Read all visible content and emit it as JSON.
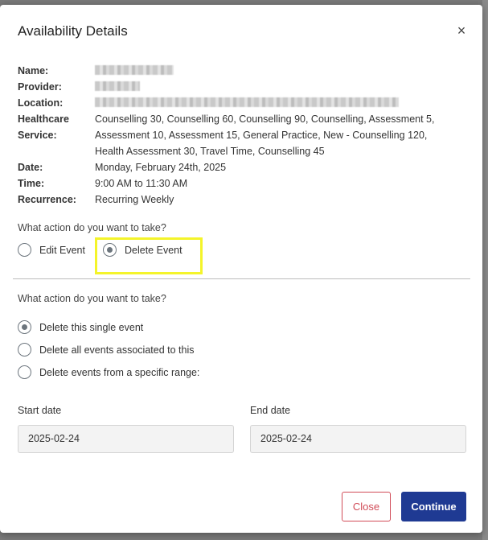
{
  "modal": {
    "title": "Availability Details",
    "close_icon": "×"
  },
  "details": {
    "name_label": "Name:",
    "provider_label": "Provider:",
    "location_label": "Location:",
    "healthcare_label_1": "Healthcare",
    "healthcare_label_2": "Service:",
    "healthcare_line_1": "Counselling 30, Counselling 60, Counselling 90, Counselling, Assessment 5,",
    "healthcare_line_2": "Assessment 10, Assessment 15, General Practice, New - Counselling 120,",
    "healthcare_line_3": "Health Assessment 30, Travel Time, Counselling 45",
    "date_label": "Date:",
    "date_value": "Monday, February 24th, 2025",
    "time_label": "Time:",
    "time_value": "9:00 AM to 11:30 AM",
    "recurrence_label": "Recurrence:",
    "recurrence_value": "Recurring Weekly"
  },
  "action": {
    "question": "What action do you want to take?",
    "options": [
      {
        "label": "Edit Event",
        "checked": false
      },
      {
        "label": "Delete Event",
        "checked": true
      }
    ]
  },
  "delete_scope": {
    "question": "What action do you want to take?",
    "options": [
      {
        "label": "Delete this single event",
        "checked": true
      },
      {
        "label": "Delete all events associated to this",
        "checked": false
      },
      {
        "label": "Delete events from a specific range:",
        "checked": false
      }
    ]
  },
  "range": {
    "start_label": "Start date",
    "start_value": "2025-02-24",
    "end_label": "End date",
    "end_value": "2025-02-24"
  },
  "buttons": {
    "close_label": "Close",
    "continue_label": "Continue"
  },
  "colors": {
    "primary": "#1f3a93",
    "danger": "#d14b57",
    "highlight": "#f4f42a"
  }
}
